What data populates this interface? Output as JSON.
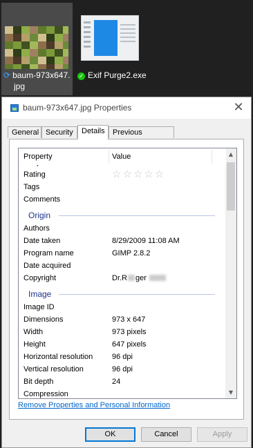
{
  "desktop": {
    "files": [
      {
        "name_line1": "baum-973x647.",
        "name_line2": "jpg",
        "status_icon": "sync-icon"
      },
      {
        "name_line1": "Exif Purge2.exe",
        "status_icon": "check-circle-icon"
      }
    ]
  },
  "dialog": {
    "title": "baum-973x647.jpg Properties",
    "tabs": [
      "General",
      "Security",
      "Details",
      "Previous Versions"
    ],
    "active_tab": "Details",
    "columns": {
      "property": "Property",
      "value": "Value"
    },
    "partial_row": "Subject",
    "rows_top": [
      {
        "label": "Rating",
        "value": "☆☆☆☆☆"
      },
      {
        "label": "Tags",
        "value": ""
      },
      {
        "label": "Comments",
        "value": ""
      }
    ],
    "group_origin": "Origin",
    "rows_origin": [
      {
        "label": "Authors",
        "value": ""
      },
      {
        "label": "Date taken",
        "value": "8/29/2009 11:08 AM"
      },
      {
        "label": "Program name",
        "value": "GIMP 2.8.2"
      },
      {
        "label": "Date acquired",
        "value": ""
      },
      {
        "label": "Copyright",
        "value": "Dr.R",
        "value_after": "ger"
      }
    ],
    "group_image": "Image",
    "rows_image": [
      {
        "label": "Image ID",
        "value": ""
      },
      {
        "label": "Dimensions",
        "value": "973 x 647"
      },
      {
        "label": "Width",
        "value": "973 pixels"
      },
      {
        "label": "Height",
        "value": "647 pixels"
      },
      {
        "label": "Horizontal resolution",
        "value": "96 dpi"
      },
      {
        "label": "Vertical resolution",
        "value": "96 dpi"
      },
      {
        "label": "Bit depth",
        "value": "24"
      }
    ],
    "partial_row_bottom": "Compression",
    "remove_link": "Remove Properties and Personal Information",
    "buttons": {
      "ok": "OK",
      "cancel": "Cancel",
      "apply": "Apply"
    }
  }
}
